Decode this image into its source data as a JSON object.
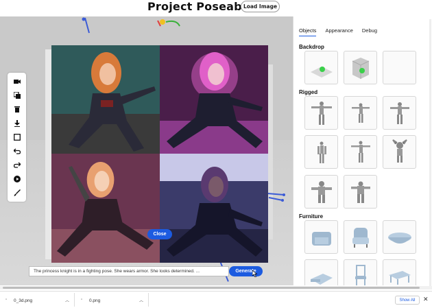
{
  "header": {
    "title": "Project Poseable",
    "load_button": "Load Image"
  },
  "viewport": {
    "close_button": "Close",
    "prompt_value": "The princess knight is in a fighting pose. She wears armor. She looks determined. ...",
    "generate_button": "Generate",
    "toolbar": [
      {
        "name": "camera-icon"
      },
      {
        "name": "duplicate-icon"
      },
      {
        "name": "trash-icon"
      },
      {
        "name": "download-icon"
      },
      {
        "name": "frame-icon"
      },
      {
        "name": "undo-icon"
      },
      {
        "name": "redo-icon"
      },
      {
        "name": "play-icon"
      },
      {
        "name": "brush-icon"
      }
    ],
    "images": [
      {
        "name": "generated-image-1",
        "hair": "#d87a3a",
        "bg": "#2f5a5a"
      },
      {
        "name": "generated-image-2",
        "hair": "#e060c8",
        "bg": "#4a1e4a"
      },
      {
        "name": "generated-image-3",
        "hair": "#e8a070",
        "bg": "#6a3550"
      },
      {
        "name": "generated-image-4",
        "hair": "#5a3a70",
        "bg": "#3b3b6a"
      }
    ]
  },
  "panel": {
    "tabs": [
      "Objects",
      "Appearance",
      "Debug"
    ],
    "active_tab": "Objects",
    "sections": {
      "backdrop": "Backdrop",
      "rigged": "Rigged",
      "furniture": "Furniture"
    },
    "backdrop_items": [
      "plane-with-ball",
      "box-with-ball",
      "empty"
    ],
    "rigged_items": [
      "figure-1",
      "figure-2",
      "figure-3",
      "figure-4",
      "figure-5",
      "figure-6",
      "figure-7",
      "figure-8"
    ],
    "furniture_items": [
      "armchair",
      "wingback-chair",
      "bathtub",
      "bed",
      "dining-chair",
      "coffee-table"
    ]
  },
  "downloads": {
    "items": [
      "0_3d.png",
      "0.png"
    ],
    "show_all": "Show All",
    "close": "✕"
  },
  "colors": {
    "accent": "#1c5be0",
    "viewport_bg": "#c9c9c9"
  }
}
